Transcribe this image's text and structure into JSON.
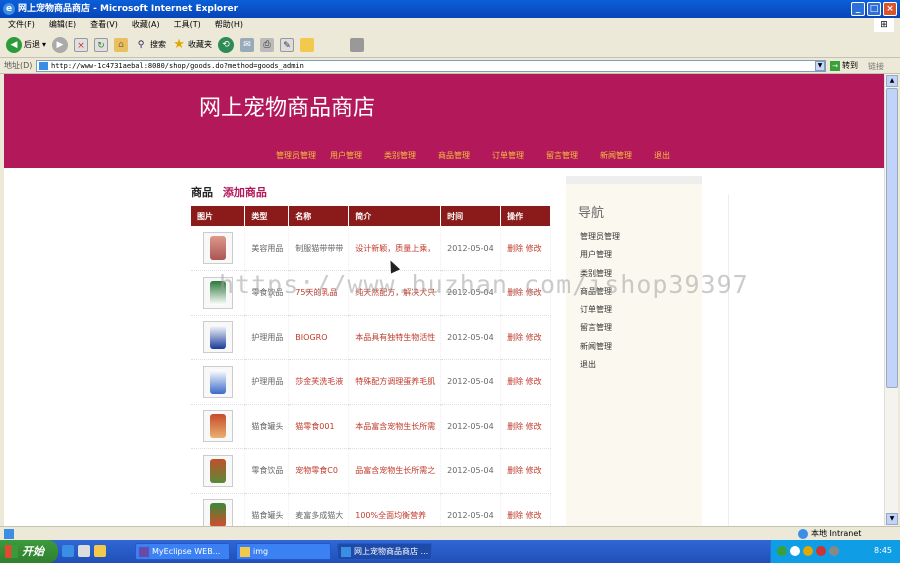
{
  "window": {
    "title": "网上宠物商品商店 - Microsoft Internet Explorer",
    "controls": [
      "_",
      "□",
      "×"
    ]
  },
  "menubar": [
    "文件(F)",
    "编辑(E)",
    "查看(V)",
    "收藏(A)",
    "工具(T)",
    "帮助(H)"
  ],
  "toolbar": {
    "back_label": "后退",
    "search_label": "搜索",
    "favorites_label": "收藏夹"
  },
  "address": {
    "label": "地址(D)",
    "url": "http://www-1c4731aebal:8080/shop/goods.do?method=goods_admin",
    "go_label": "转到",
    "links_label": "链接"
  },
  "site": {
    "title": "网上宠物商品商店",
    "nav": [
      "管理员管理",
      "用户管理",
      "类别管理",
      "商品管理",
      "订单管理",
      "留言管理",
      "新闻管理",
      "退出"
    ]
  },
  "main": {
    "section_label": "商品",
    "add_label": "添加商品",
    "columns": [
      "图片",
      "类型",
      "名称",
      "简介",
      "时间",
      "操作"
    ],
    "rows": [
      {
        "type": "美容用品",
        "name": "制服猫带带带",
        "desc": "设计新颖，质量上乘，",
        "date": "2012-05-04",
        "delete": "删除",
        "edit": "修改"
      },
      {
        "type": "零食饮品",
        "name": "75天的乳品",
        "desc": "纯天然配方，解决犬只",
        "date": "2012-05-04",
        "delete": "删除",
        "edit": "修改"
      },
      {
        "type": "护理用品",
        "name": "BIOGRO",
        "desc": "本品具有独特生物活性",
        "date": "2012-05-04",
        "delete": "删除",
        "edit": "修改"
      },
      {
        "type": "护理用品",
        "name": "莎金芙洗毛液",
        "desc": "特殊配方调理蛋养毛肌",
        "date": "2012-05-04",
        "delete": "删除",
        "edit": "修改"
      },
      {
        "type": "猫食罐头",
        "name": "猫零食001",
        "desc": "本品富含宠物生长所需",
        "date": "2012-05-04",
        "delete": "删除",
        "edit": "修改"
      },
      {
        "type": "零食饮品",
        "name": "宠物零食C0",
        "desc": "品富含宠物生长所需之",
        "date": "2012-05-04",
        "delete": "删除",
        "edit": "修改"
      },
      {
        "type": "猫食罐头",
        "name": "麦富多成猫大",
        "desc": "100%全面均衡营养",
        "date": "2012-05-04",
        "delete": "删除",
        "edit": "修改"
      }
    ]
  },
  "sidebar": {
    "title": "导航",
    "items": [
      "管理员管理",
      "用户管理",
      "类别管理",
      "商品管理",
      "订单管理",
      "留言管理",
      "新闻管理",
      "退出"
    ]
  },
  "watermark": "https://www.huzhan.com/ishop39397",
  "statusbar": {
    "zone": "本地 Intranet"
  },
  "taskbar": {
    "start_label": "开始",
    "tasks": [
      "MyEclipse WEB...",
      "img",
      "网上宠物商品商店 ..."
    ],
    "clock": "8:45"
  },
  "colors": {
    "header": "#b3185a",
    "nav_text": "#f6c13d",
    "table_header": "#8b1a1a",
    "link_red": "#c0392b"
  }
}
